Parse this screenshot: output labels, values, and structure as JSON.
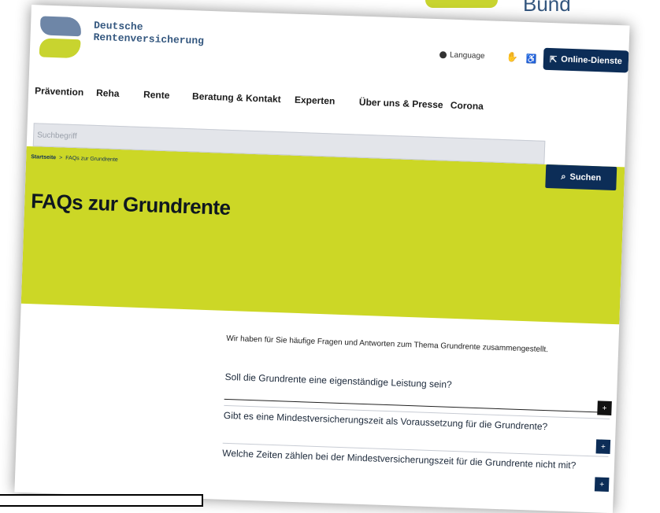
{
  "corner": {
    "badge_text": "Bund"
  },
  "header": {
    "brand_line1": "Deutsche",
    "brand_line2": "Rentenversicherung",
    "language_label": "Language",
    "online_button_label": "Online-Dienste"
  },
  "nav": {
    "items": [
      {
        "label": "Prävention"
      },
      {
        "label": "Reha"
      },
      {
        "label": "Rente"
      },
      {
        "label": "Beratung & Kontakt"
      },
      {
        "label": "Experten"
      },
      {
        "label": "Über uns & Presse"
      },
      {
        "label": "Corona"
      }
    ]
  },
  "search": {
    "placeholder": "Suchbegriff",
    "button_label": "Suchen"
  },
  "breadcrumb": {
    "home": "Startseite",
    "separator": ">",
    "current": "FAQs zur Grundrente"
  },
  "main": {
    "title": "FAQs zur Grundrente",
    "intro": "Wir haben für Sie häufige Fragen und Antworten zum Thema Grundrente zusammengestellt.",
    "faqs": [
      {
        "question": "Soll die Grundrente eine eigenständige Leistung sein?",
        "toggle": "+"
      },
      {
        "question": "Gibt es eine Mindestversicherungszeit als Voraussetzung für die Grundrente?",
        "toggle": "+"
      },
      {
        "question": "Welche Zeiten zählen bei der Mindestversicherungszeit für die Grundrente nicht mit?",
        "toggle": "+"
      }
    ]
  },
  "colors": {
    "brand_green": "#ccd726",
    "brand_navy": "#0c2d57",
    "brand_blue_grey": "#6e86a7"
  }
}
